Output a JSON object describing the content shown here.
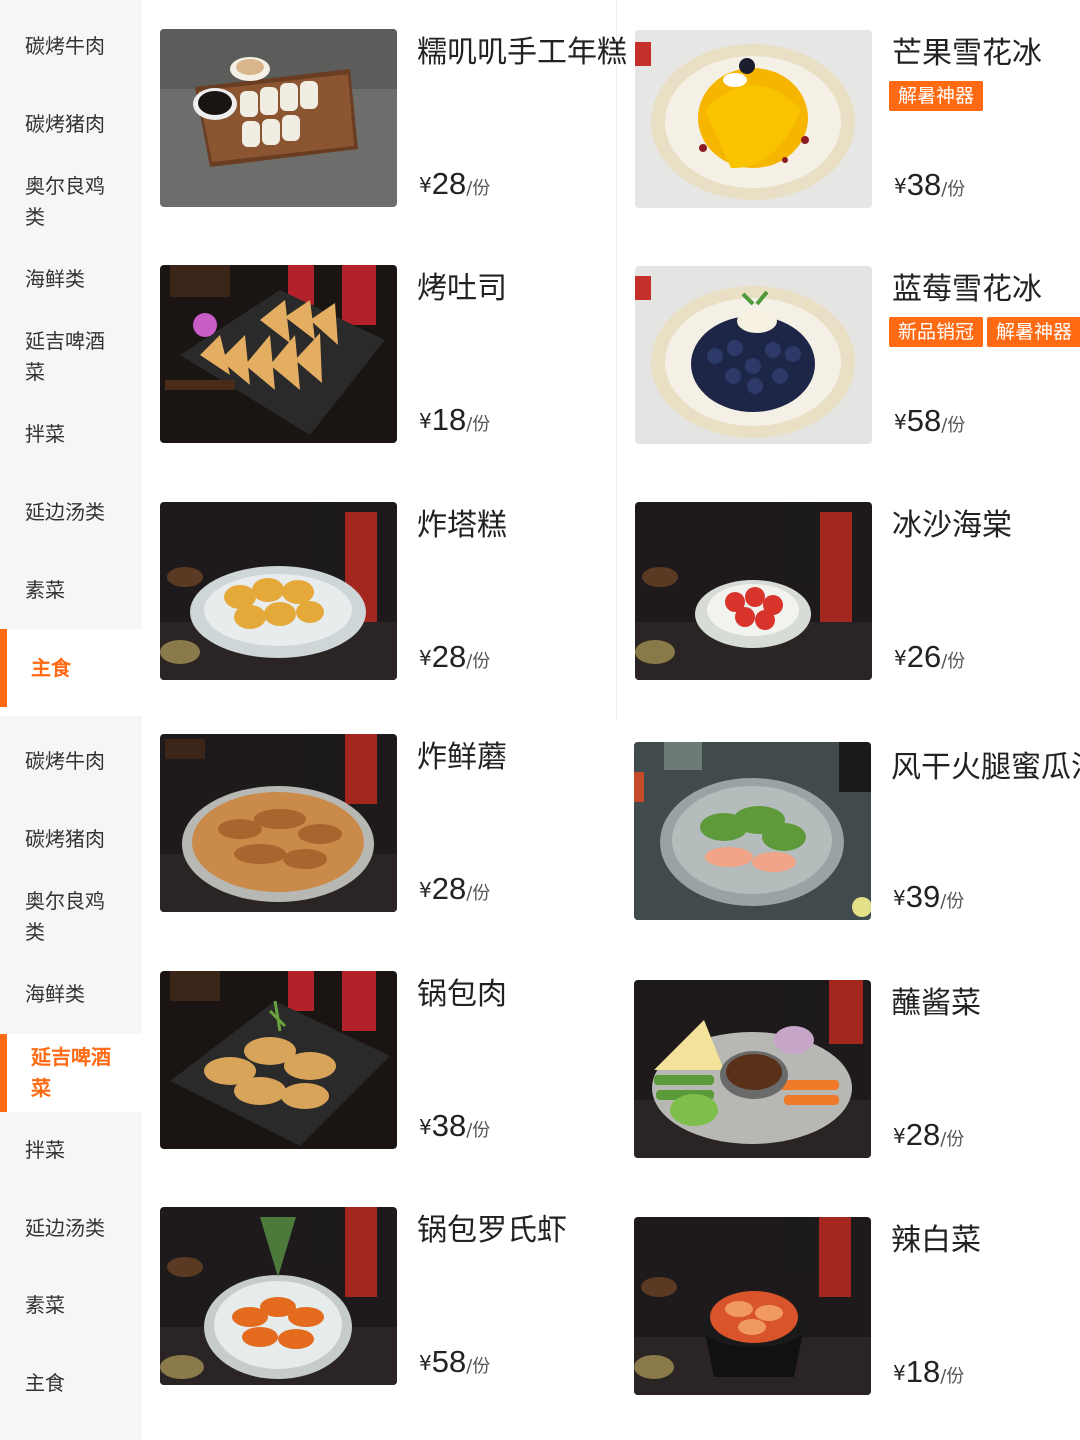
{
  "sidebar_top": [
    {
      "label": "碳烤牛肉",
      "active": false
    },
    {
      "label": "碳烤猪肉",
      "active": false
    },
    {
      "label": "奥尔良鸡\n类",
      "active": false
    },
    {
      "label": "海鲜类",
      "active": false
    },
    {
      "label": "延吉啤酒\n菜",
      "active": false
    },
    {
      "label": "拌菜",
      "active": false
    },
    {
      "label": "延边汤类",
      "active": false
    },
    {
      "label": "素菜",
      "active": false
    },
    {
      "label": "主食",
      "active": true
    }
  ],
  "sidebar_bottom": [
    {
      "label": "碳烤牛肉",
      "active": false
    },
    {
      "label": "碳烤猪肉",
      "active": false
    },
    {
      "label": "奥尔良鸡\n类",
      "active": false
    },
    {
      "label": "海鲜类",
      "active": false
    },
    {
      "label": "延吉啤酒\n菜",
      "active": true
    },
    {
      "label": "拌菜",
      "active": false
    },
    {
      "label": "延边汤类",
      "active": false
    },
    {
      "label": "素菜",
      "active": false
    },
    {
      "label": "主食",
      "active": false
    }
  ],
  "currency": "¥",
  "unit": "/份",
  "accent_color": "#ff6a13",
  "dishes": [
    {
      "name": "糯叽叽手工年糕",
      "price": "28",
      "tags": [],
      "image": "rice-cake-board-image"
    },
    {
      "name": "芒果雪花冰",
      "price": "38",
      "tags": [
        "解暑神器"
      ],
      "image": "mango-shaved-ice-image"
    },
    {
      "name": "烤吐司",
      "price": "18",
      "tags": [],
      "image": "toast-platter-image"
    },
    {
      "name": "蓝莓雪花冰",
      "price": "58",
      "tags": [
        "新品销冠",
        "解暑神器"
      ],
      "image": "blueberry-shaved-ice-image"
    },
    {
      "name": "炸塔糕",
      "price": "28",
      "tags": [],
      "image": "fried-rice-cake-image"
    },
    {
      "name": "冰沙海棠",
      "price": "26",
      "tags": [],
      "image": "begonia-slush-image"
    },
    {
      "name": "炸鲜蘑",
      "price": "28",
      "tags": [],
      "image": "fried-mushroom-image"
    },
    {
      "name": "风干火腿蜜瓜沙拉",
      "price": "39",
      "tags": [],
      "image": "ham-melon-salad-image"
    },
    {
      "name": "锅包肉",
      "price": "38",
      "tags": [],
      "image": "sweet-sour-pork-image"
    },
    {
      "name": "蘸酱菜",
      "price": "28",
      "tags": [],
      "image": "dipping-vegetables-image"
    },
    {
      "name": "锅包罗氏虾",
      "price": "58",
      "tags": [],
      "image": "shrimp-plate-image"
    },
    {
      "name": "辣白菜",
      "price": "18",
      "tags": [],
      "image": "kimchi-image"
    }
  ]
}
